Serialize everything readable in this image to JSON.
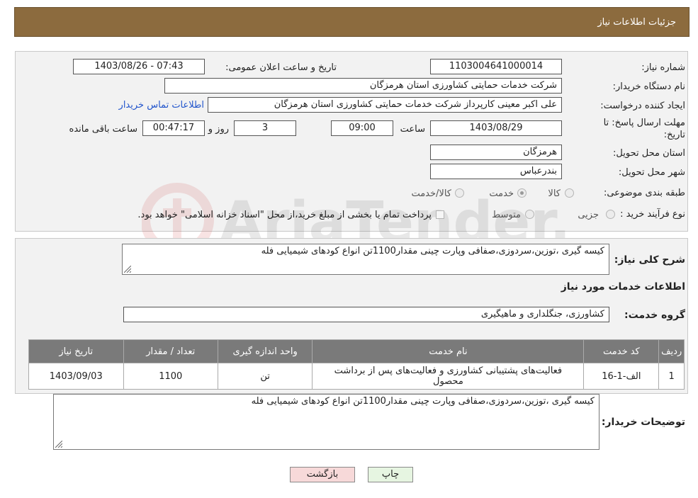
{
  "header": {
    "title": "جزئیات اطلاعات نیاز"
  },
  "form": {
    "need_number_label": "شماره نیاز:",
    "need_number": "1103004641000014",
    "announce_label": "تاریخ و ساعت اعلان عمومی:",
    "announce_value": "1403/08/26 - 07:43",
    "buyer_label": "نام دستگاه خریدار:",
    "buyer_value": "شرکت خدمات حمایتی کشاورزی استان هرمزگان",
    "creator_label": "ایجاد کننده درخواست:",
    "creator_value": "علی اکبر معینی کارپرداز شرکت خدمات حمایتی کشاورزی استان هرمزگان",
    "contact_link": "اطلاعات تماس خریدار",
    "deadline_label_1": "مهلت ارسال پاسخ: تا",
    "deadline_label_2": "تاریخ:",
    "deadline_date": "1403/08/29",
    "time_label": "ساعت",
    "deadline_time": "09:00",
    "days_value": "3",
    "days_label": "روز و",
    "remaining_time": "00:47:17",
    "remaining_label": "ساعت باقی مانده",
    "province_label": "استان محل تحویل:",
    "province_value": "هرمزگان",
    "city_label": "شهر محل تحویل:",
    "city_value": "بندرعباس",
    "category_label": "طبقه بندی موضوعی:",
    "category_options": [
      "کالا",
      "خدمت",
      "کالا/خدمت"
    ],
    "category_selected": "خدمت",
    "process_label": "نوع فرآیند خرید :",
    "process_options": [
      "جزیی",
      "متوسط"
    ],
    "payment_note": "پرداخت تمام یا بخشی از مبلغ خرید،از محل \"اسناد خزانه اسلامی\" خواهد بود."
  },
  "description": {
    "label": "شرح کلی نیاز:",
    "value": "کیسه گیری ،توزین،سردوزی،صفافی وپارت چینی مقدار1100تن انواع کودهای شیمیایی فله"
  },
  "services_heading": "اطلاعات خدمات مورد نیاز",
  "service_group": {
    "label": "گروه خدمت:",
    "value": "کشاورزی، جنگلداری و ماهیگیری"
  },
  "table": {
    "headers": [
      "ردیف",
      "کد خدمت",
      "نام خدمت",
      "واحد اندازه گیری",
      "تعداد / مقدار",
      "تاریخ نیاز"
    ],
    "rows": [
      {
        "row": "1",
        "code": "الف-1-16",
        "name_line1": "فعالیت‌های پشتیبانی کشاورزی و فعالیت‌های پس از برداشت",
        "name_line2": "محصول",
        "unit": "تن",
        "quantity": "1100",
        "date": "1403/09/03"
      }
    ]
  },
  "buyer_notes": {
    "label": "توضیحات خریدار:",
    "value": "کیسه گیری ،توزین،سردوزی،صفافی وپارت چینی مقدار1100تن انواع کودهای شیمیایی فله"
  },
  "buttons": {
    "print": "چاپ",
    "back": "بازگشت"
  },
  "watermark": {
    "text": "AriaTender.neT"
  },
  "colors": {
    "header": "#8c6b3e",
    "table_header": "#7a7a7a",
    "link": "#2255cc",
    "back_button": "#f7d9d9",
    "print_button": "#e6f5e1"
  }
}
